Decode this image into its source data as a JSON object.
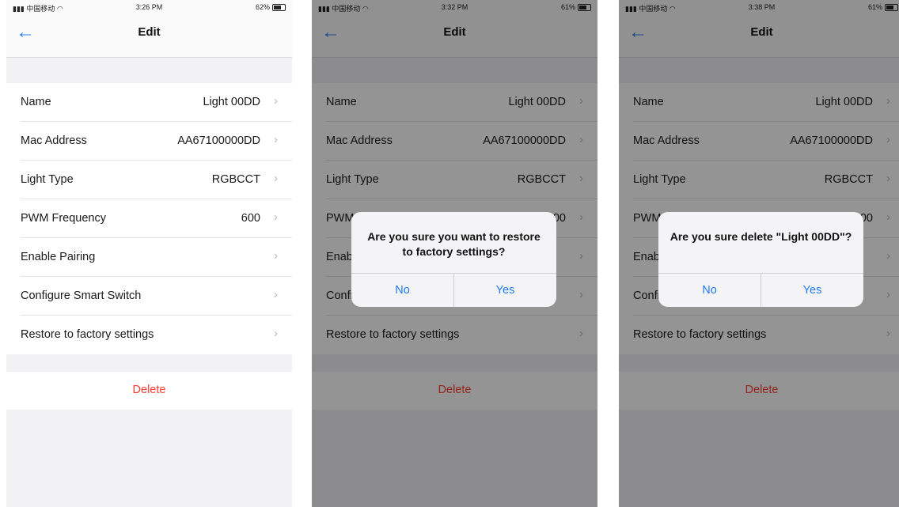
{
  "screens": [
    {
      "status": {
        "carrier": "中国移动",
        "time": "3:26 PM",
        "battery": "62%"
      },
      "nav": {
        "title": "Edit"
      },
      "rows": [
        {
          "label": "Name",
          "value": "Light 00DD"
        },
        {
          "label": "Mac Address",
          "value": "AA67100000DD"
        },
        {
          "label": "Light Type",
          "value": "RGBCCT"
        },
        {
          "label": "PWM Frequency",
          "value": "600"
        },
        {
          "label": "Enable Pairing",
          "value": ""
        },
        {
          "label": "Configure Smart Switch",
          "value": ""
        },
        {
          "label": "Restore to factory settings",
          "value": ""
        }
      ],
      "delete_label": "Delete"
    },
    {
      "status": {
        "carrier": "中国移动",
        "time": "3:32 PM",
        "battery": "61%"
      },
      "nav": {
        "title": "Edit"
      },
      "rows": [
        {
          "label": "Name",
          "value": "Light 00DD"
        },
        {
          "label": "Mac Address",
          "value": "AA67100000DD"
        },
        {
          "label": "Light Type",
          "value": "RGBCCT"
        },
        {
          "label": "PWM Frequency",
          "value": "600"
        },
        {
          "label": "Enable Pairing",
          "value": ""
        },
        {
          "label": "Configure Smart Switch",
          "value": ""
        },
        {
          "label": "Restore to factory settings",
          "value": ""
        }
      ],
      "delete_label": "Delete",
      "alert": {
        "message": "Are you sure you want to restore to factory settings?",
        "no": "No",
        "yes": "Yes"
      }
    },
    {
      "status": {
        "carrier": "中国移动",
        "time": "3:38 PM",
        "battery": "61%"
      },
      "nav": {
        "title": "Edit"
      },
      "rows": [
        {
          "label": "Name",
          "value": "Light 00DD"
        },
        {
          "label": "Mac Address",
          "value": "AA67100000DD"
        },
        {
          "label": "Light Type",
          "value": "RGBCCT"
        },
        {
          "label": "PWM Frequency",
          "value": "600"
        },
        {
          "label": "Enable Pairing",
          "value": ""
        },
        {
          "label": "Configure Smart Switch",
          "value": ""
        },
        {
          "label": "Restore to factory settings",
          "value": ""
        }
      ],
      "delete_label": "Delete",
      "alert": {
        "message": "Are you sure delete \"Light 00DD\"?",
        "no": "No",
        "yes": "Yes"
      }
    }
  ],
  "colors": {
    "accent": "#2f7cf6",
    "destructive": "#ff3b30",
    "chevron": "#b8b8bd"
  },
  "icons": {
    "back": "back-arrow-icon",
    "chevron": "chevron-right-icon",
    "battery": "battery-icon",
    "signal": "signal-icon",
    "wifi": "wifi-icon"
  }
}
